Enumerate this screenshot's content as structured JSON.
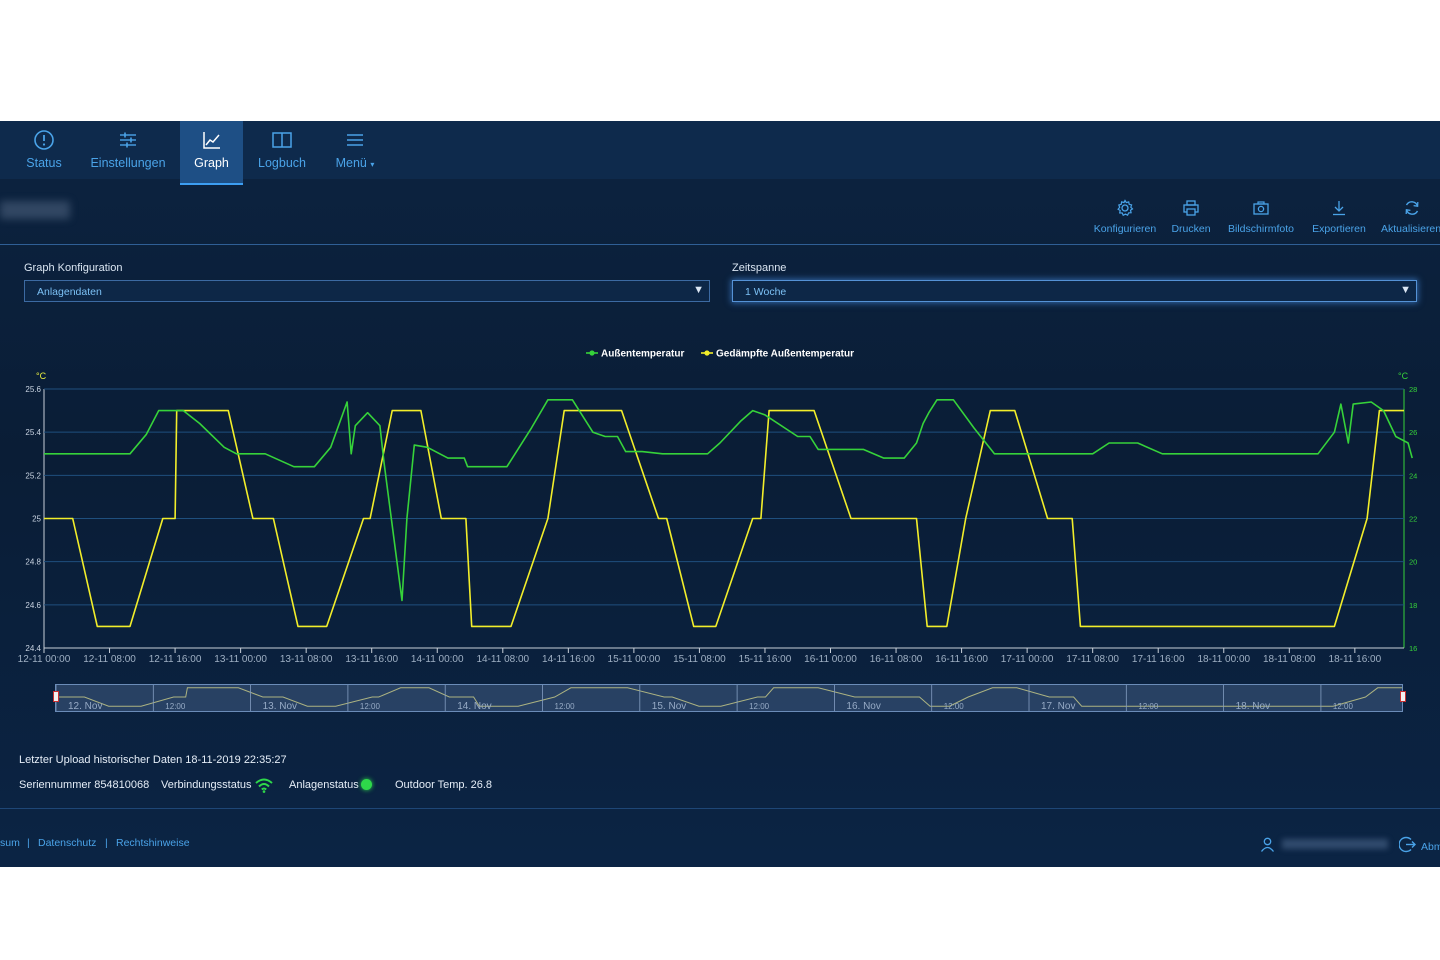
{
  "nav": {
    "tabs": [
      {
        "label": "Status",
        "icon": "info-icon"
      },
      {
        "label": "Einstellungen",
        "icon": "sliders-icon"
      },
      {
        "label": "Graph",
        "icon": "chart-icon",
        "active": true
      },
      {
        "label": "Logbuch",
        "icon": "book-icon"
      },
      {
        "label": "Menü",
        "icon": "hamburger-icon",
        "dropdown": true
      }
    ]
  },
  "toolbar": {
    "konfigurieren": "Konfigurieren",
    "drucken": "Drucken",
    "bildschirmfoto": "Bildschirmfoto",
    "exportieren": "Exportieren",
    "aktualisieren": "Aktualisieren"
  },
  "form": {
    "graph_label": "Graph Konfiguration",
    "graph_value": "Anlagendaten",
    "span_label": "Zeitspanne",
    "span_value": "1 Woche"
  },
  "chart_data": {
    "type": "line",
    "legend": [
      "Außentemperatur",
      "Gedämpfte Außentemperatur"
    ],
    "legend_position": "top-center",
    "y_left": {
      "label": "°C",
      "ticks": [
        "25.6",
        "25.4",
        "25.2",
        "25",
        "24.8",
        "24.6",
        "24.4"
      ],
      "range": [
        24.4,
        25.6
      ]
    },
    "y_right": {
      "label": "°C",
      "ticks": [
        "28",
        "26",
        "24",
        "22",
        "20",
        "18",
        "16"
      ],
      "range": [
        16,
        28
      ]
    },
    "x_ticks": [
      "12-11 00:00",
      "12-11 08:00",
      "12-11 16:00",
      "13-11 00:00",
      "13-11 08:00",
      "13-11 16:00",
      "14-11 00:00",
      "14-11 08:00",
      "14-11 16:00",
      "15-11 00:00",
      "15-11 08:00",
      "15-11 16:00",
      "16-11 00:00",
      "16-11 08:00",
      "16-11 16:00",
      "17-11 00:00",
      "17-11 08:00",
      "17-11 16:00",
      "18-11 00:00",
      "18-11 08:00",
      "18-11 16:00"
    ],
    "x_range_hours": [
      0,
      166
    ],
    "series": [
      {
        "name": "Gedämpfte Außentemperatur",
        "color": "#f2ee2a",
        "axis": "left",
        "points": [
          [
            0,
            25.0
          ],
          [
            3.5,
            25.0
          ],
          [
            6.5,
            24.5
          ],
          [
            10.5,
            24.5
          ],
          [
            14.5,
            25.0
          ],
          [
            16,
            25.0
          ],
          [
            16.2,
            25.5
          ],
          [
            22.5,
            25.5
          ],
          [
            25.5,
            25.0
          ],
          [
            28,
            25.0
          ],
          [
            31,
            24.5
          ],
          [
            34.5,
            24.5
          ],
          [
            39,
            25.0
          ],
          [
            39.8,
            25.0
          ],
          [
            42.5,
            25.5
          ],
          [
            46,
            25.5
          ],
          [
            48.5,
            25.0
          ],
          [
            51.5,
            25.0
          ],
          [
            52.2,
            24.5
          ],
          [
            57,
            24.5
          ],
          [
            61.5,
            25.0
          ],
          [
            63.5,
            25.5
          ],
          [
            70.5,
            25.5
          ],
          [
            75,
            25.0
          ],
          [
            76,
            25.0
          ],
          [
            79.3,
            24.5
          ],
          [
            82,
            24.5
          ],
          [
            86.5,
            25.0
          ],
          [
            87.5,
            25.0
          ],
          [
            88.5,
            25.5
          ],
          [
            94,
            25.5
          ],
          [
            98.5,
            25.0
          ],
          [
            106.5,
            25.0
          ],
          [
            107.8,
            24.5
          ],
          [
            110,
            24.5
          ],
          [
            110.2,
            24.5
          ],
          [
            112.5,
            25.0
          ],
          [
            115.5,
            25.5
          ],
          [
            118.5,
            25.5
          ],
          [
            122.5,
            25.0
          ],
          [
            125.5,
            25.0
          ],
          [
            126.5,
            24.5
          ],
          [
            157.5,
            24.5
          ],
          [
            161.5,
            25.0
          ],
          [
            163,
            25.5
          ],
          [
            166,
            25.5
          ]
        ]
      },
      {
        "name": "Außentemperatur",
        "color": "#36d23a",
        "axis": "right",
        "points": [
          [
            0,
            25.0
          ],
          [
            10.5,
            25.0
          ],
          [
            12.5,
            25.9
          ],
          [
            14,
            27.0
          ],
          [
            17,
            27.0
          ],
          [
            19,
            26.4
          ],
          [
            22,
            25.3
          ],
          [
            23.5,
            25.0
          ],
          [
            27,
            25.0
          ],
          [
            30.5,
            24.4
          ],
          [
            33,
            24.4
          ],
          [
            35,
            25.3
          ],
          [
            37,
            27.4
          ],
          [
            37.5,
            25.0
          ],
          [
            38,
            26.3
          ],
          [
            39.5,
            26.9
          ],
          [
            41,
            26.3
          ],
          [
            41.5,
            24.6
          ],
          [
            43.7,
            18.2
          ],
          [
            44.3,
            22.0
          ],
          [
            45.2,
            25.4
          ],
          [
            46.8,
            25.3
          ],
          [
            49.3,
            24.8
          ],
          [
            51.3,
            24.8
          ],
          [
            51.7,
            24.4
          ],
          [
            56.5,
            24.4
          ],
          [
            59.5,
            26.2
          ],
          [
            61.5,
            27.5
          ],
          [
            64.5,
            27.5
          ],
          [
            67,
            26.0
          ],
          [
            68.5,
            25.8
          ],
          [
            70,
            25.8
          ],
          [
            71,
            25.1
          ],
          [
            73,
            25.1
          ],
          [
            75.5,
            25.0
          ],
          [
            81,
            25.0
          ],
          [
            82.5,
            25.5
          ],
          [
            85,
            26.5
          ],
          [
            86.5,
            27.0
          ],
          [
            88,
            26.8
          ],
          [
            92,
            25.8
          ],
          [
            93.5,
            25.8
          ],
          [
            94.5,
            25.2
          ],
          [
            97,
            25.2
          ],
          [
            100,
            25.2
          ],
          [
            102.5,
            24.8
          ],
          [
            105,
            24.8
          ],
          [
            106.5,
            25.5
          ],
          [
            107.3,
            26.4
          ],
          [
            108,
            26.9
          ],
          [
            109,
            27.5
          ],
          [
            111,
            27.5
          ],
          [
            113.5,
            26.2
          ],
          [
            116,
            25.0
          ],
          [
            118.5,
            25.0
          ],
          [
            124.5,
            25.0
          ],
          [
            128,
            25.0
          ],
          [
            130,
            25.5
          ],
          [
            133.5,
            25.5
          ],
          [
            136.5,
            25.0
          ],
          [
            145,
            25.0
          ],
          [
            155.5,
            25.0
          ],
          [
            157.5,
            26.0
          ],
          [
            158.3,
            27.3
          ],
          [
            159.2,
            25.5
          ],
          [
            159.8,
            27.3
          ],
          [
            162,
            27.4
          ],
          [
            163.5,
            27.0
          ],
          [
            165,
            25.8
          ],
          [
            166.5,
            25.5
          ],
          [
            167,
            24.8
          ]
        ]
      }
    ],
    "navigator": {
      "labels": [
        "12. Nov",
        "12:00",
        "13. Nov",
        "12:00",
        "14. Nov",
        "12:00",
        "15. Nov",
        "12:00",
        "16. Nov",
        "12:00",
        "17. Nov",
        "12:00",
        "18. Nov",
        "12:00"
      ]
    }
  },
  "info": {
    "last_upload": "Letzter Upload historischer Daten 18-11-2019 22:35:27",
    "serial": "Seriennummer 854810068",
    "connection": "Verbindungsstatus",
    "system_status": "Anlagenstatus",
    "outdoor": "Outdoor Temp. 26.8"
  },
  "footer": {
    "impressum": "sum",
    "datenschutz": "Datenschutz",
    "rechtshinweise": "Rechtshinweise",
    "logout": "Abm"
  }
}
